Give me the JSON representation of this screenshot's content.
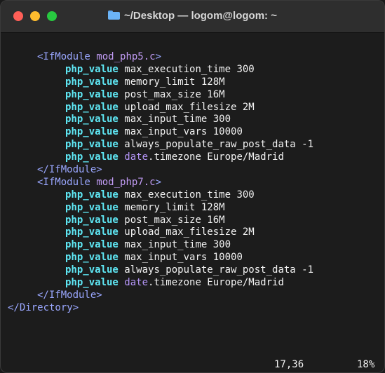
{
  "window": {
    "title": "~/Desktop — logom@logom: ~",
    "controls": {
      "close_color": "#ff5f57",
      "minimize_color": "#febc2e",
      "zoom_color": "#28c840"
    }
  },
  "code": {
    "module1_open": {
      "tag": "<IfModule",
      "name": "mod_php5.c",
      "close": ">"
    },
    "module2_open": {
      "tag": "<IfModule",
      "name": "mod_php7.c",
      "close": ">"
    },
    "module_close": "</IfModule>",
    "directory_close": "</Directory>",
    "keyword": "php_value",
    "directives": [
      {
        "text": "max_execution_time 300"
      },
      {
        "text": "memory_limit 128M"
      },
      {
        "text": "post_max_size 16M"
      },
      {
        "text": "upload_max_filesize 2M"
      },
      {
        "text": "max_input_time 300"
      },
      {
        "text": "max_input_vars 10000"
      },
      {
        "text": "always_populate_raw_post_data -1"
      },
      {
        "prefix": "date",
        "text": ".timezone Europe/Madrid"
      }
    ]
  },
  "status": {
    "position": "17,36",
    "percent": "18%"
  },
  "colors": {
    "keyword": "#5fe8f5",
    "tag": "#9aa7ff",
    "module": "#c29cf5",
    "prop": "#b495f7",
    "text": "#f2f2f2",
    "background": "#1c1c1c"
  },
  "icons": {
    "title": "folder-icon"
  }
}
